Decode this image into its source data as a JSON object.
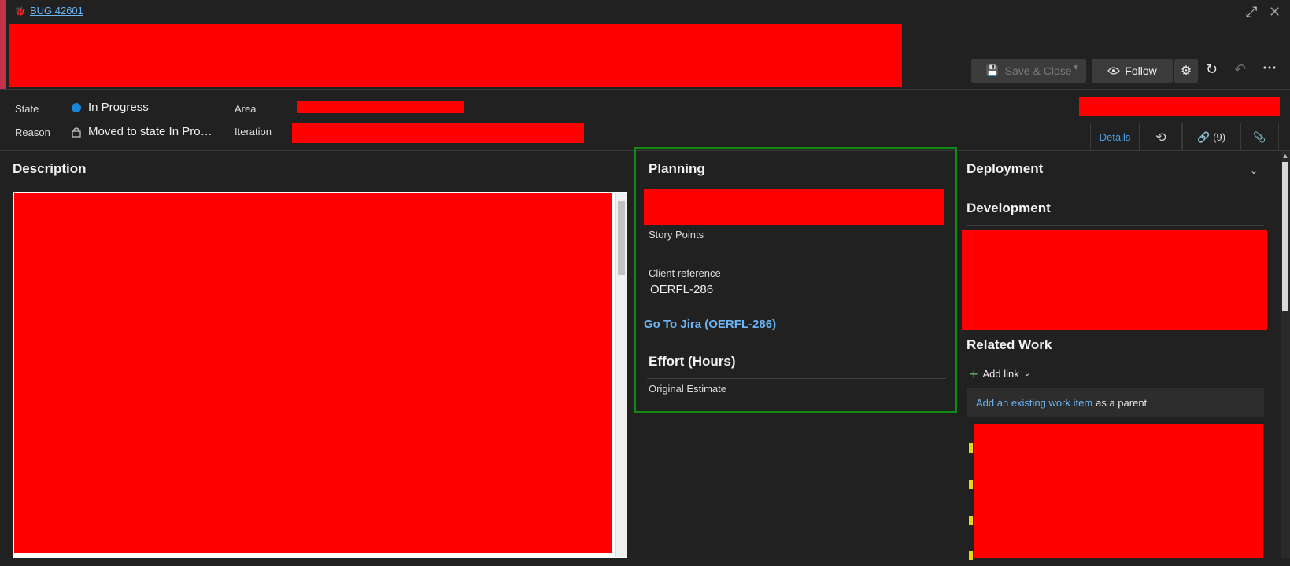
{
  "header": {
    "work_item_link": "BUG 42601",
    "save_close_label": "Save & Close",
    "follow_label": "Follow"
  },
  "fields": {
    "state_label": "State",
    "state_value": "In Progress",
    "reason_label": "Reason",
    "reason_value": "Moved to state In Pro…",
    "area_label": "Area",
    "iteration_label": "Iteration"
  },
  "tabs": {
    "details_label": "Details",
    "links_count": "(9)"
  },
  "description": {
    "title": "Description"
  },
  "planning": {
    "title": "Planning",
    "story_points_label": "Story Points",
    "client_reference_label": "Client reference",
    "client_reference_value": "OERFL-286",
    "jira_link": "Go To Jira (OERFL-286)",
    "effort_title": "Effort (Hours)",
    "original_estimate_label": "Original Estimate"
  },
  "right": {
    "deployment_title": "Deployment",
    "development_title": "Development",
    "related_work_title": "Related Work",
    "add_link_label": "Add link",
    "add_existing_link": "Add an existing work item",
    "as_parent_text": "as a parent"
  },
  "colors": {
    "state_dot": "#1a86d9",
    "planning_border": "#118a11",
    "link": "#6cb4f5",
    "accent_bar": "#c4314b"
  }
}
